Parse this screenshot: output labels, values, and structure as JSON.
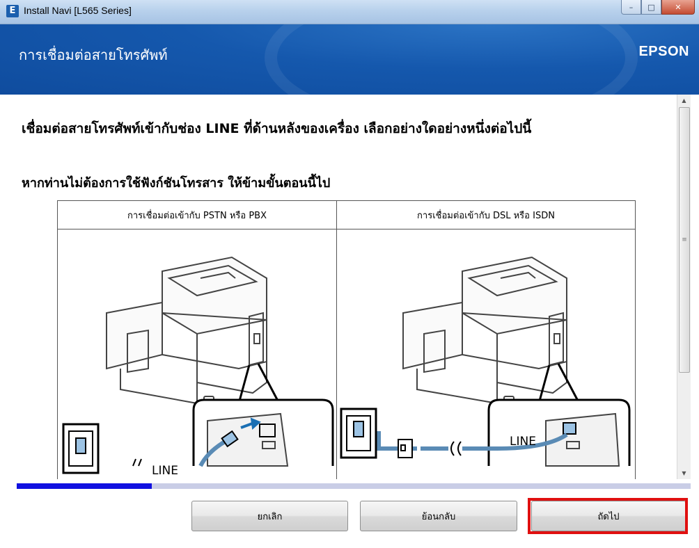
{
  "window": {
    "title": "Install Navi [L565 Series]",
    "icon_letter": "E",
    "min_symbol": "–",
    "max_symbol": "□",
    "close_symbol": "✕"
  },
  "header": {
    "title": "การเชื่อมต่อสายโทรศัพท์",
    "brand": "EPSON"
  },
  "content": {
    "instruction": "เชื่อมต่อสายโทรศัพท์เข้ากับช่อง LINE ที่ด้านหลังของเครื่อง เลือกอย่างใดอย่างหนึ่งต่อไปนี้",
    "skip_note": "หากท่านไม่ต้องการใช้ฟังก์ชันโทรสาร ให้ข้ามขั้นตอนนี้ไป",
    "diagram": {
      "left_header": "การเชื่อมต่อเข้ากับ PSTN หรือ PBX",
      "right_header": "การเชื่อมต่อเข้ากับ DSL หรือ ISDN",
      "left_port_label": "LINE",
      "right_port_label": "LINE"
    }
  },
  "scrollbar": {
    "up": "▲",
    "down": "▼",
    "grip": "≡"
  },
  "progress": {
    "fraction": 0.2
  },
  "buttons": {
    "cancel": "ยกเลิก",
    "back": "ย้อนกลับ",
    "next": "ถัดไป"
  },
  "colors": {
    "header_blue": "#1558ad",
    "progress_fill": "#1010e0",
    "highlight_red": "#e01010"
  }
}
